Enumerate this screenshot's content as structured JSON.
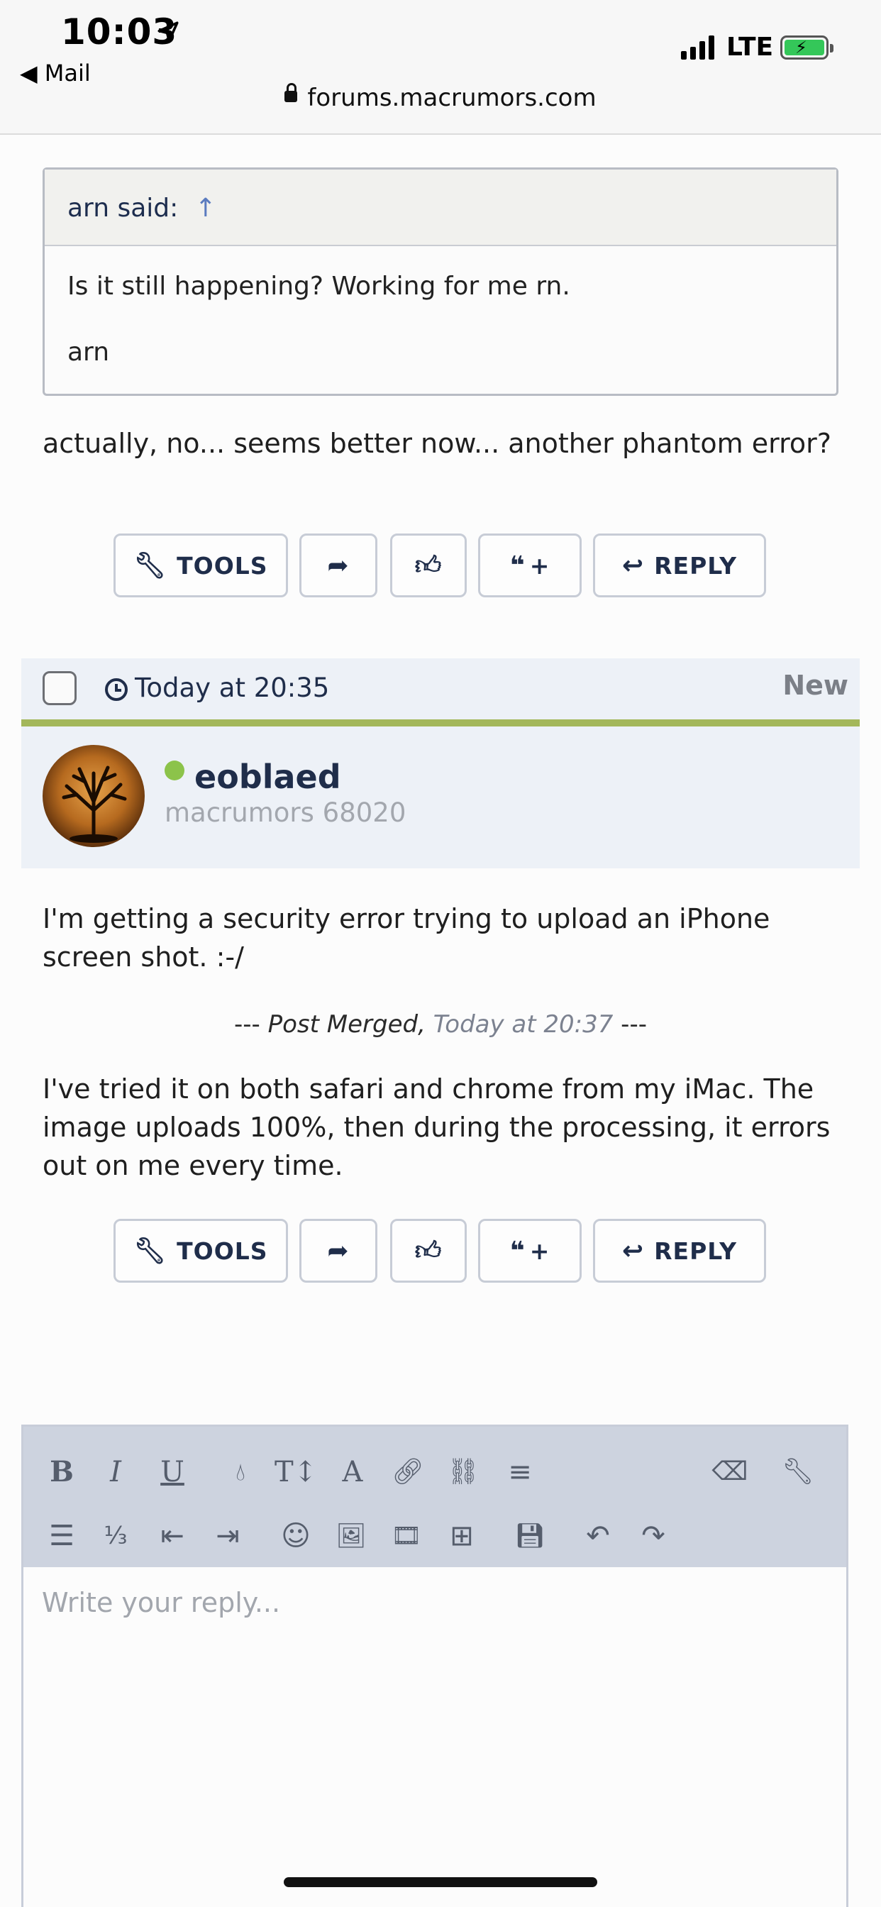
{
  "status_bar": {
    "time": "10:03",
    "back_label": "◀ Mail",
    "network": "LTE",
    "url": "forums.macrumors.com"
  },
  "quote": {
    "author_line": "arn said:",
    "arrow": "↑",
    "body": "Is it still happening? Working for me rn.",
    "signature": "arn"
  },
  "post1": {
    "text": "actually, no... seems better now... another phantom error?"
  },
  "actions": {
    "tools_label": "TOOLS",
    "reply_label": "REPLY",
    "quote_plus_label": "+"
  },
  "post2": {
    "time": "Today at 20:35",
    "badge": "New",
    "username": "eoblaed",
    "user_title": "macrumors 68020",
    "text1": "I'm getting a security error trying to upload an iPhone screen shot. :-/",
    "merge_prefix": "--- ",
    "merge_label": "Post Merged,",
    "merge_time": "Today at 20:37",
    "merge_suffix": " ---",
    "text2": "I've tried it on both safari and chrome from my iMac. The image uploads 100%, then during the processing, it errors out on me every time."
  },
  "editor": {
    "placeholder": "Write your reply..."
  },
  "colors": {
    "accent_green": "#a3b75a",
    "online": "#8cc34a",
    "navy": "#1f2d4a"
  }
}
